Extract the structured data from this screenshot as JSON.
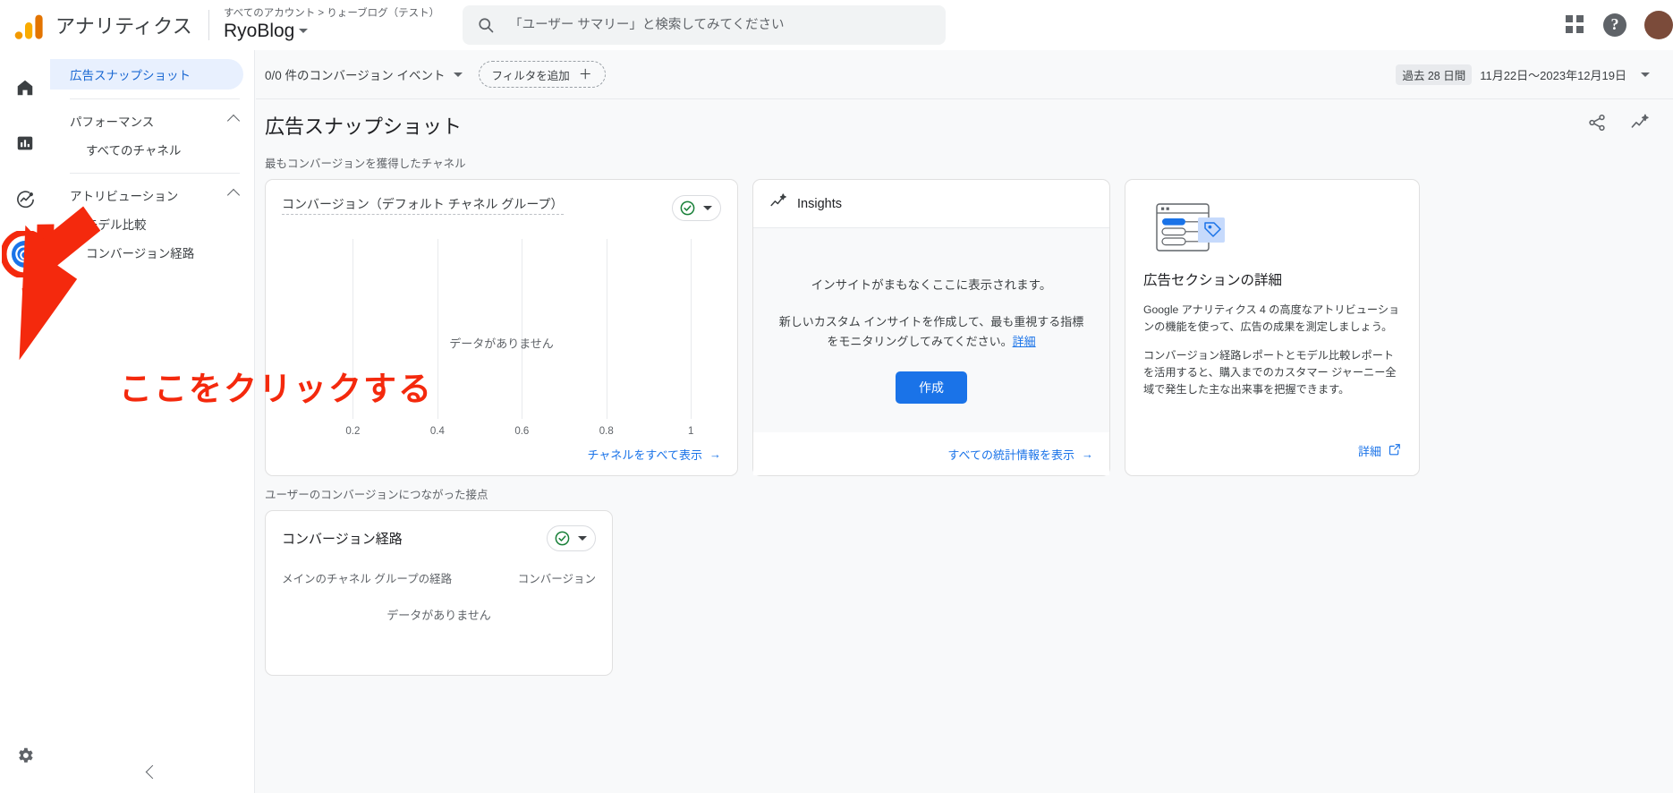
{
  "header": {
    "product_name": "アナリティクス",
    "account_path": "すべてのアカウント > りょーブログ（テスト）",
    "property_name": "RyoBlog",
    "search_placeholder": "「ユーザー サマリー」と検索してみてください",
    "icons": {
      "logo": "google-analytics-logo",
      "search": "search-icon",
      "apps": "apps-grid-icon",
      "help": "help-icon",
      "avatar": "user-avatar"
    }
  },
  "rail": {
    "items": [
      {
        "name": "home",
        "label": "ホーム",
        "icon": "home-icon",
        "active": false
      },
      {
        "name": "reports",
        "label": "レポート",
        "icon": "bar-chart-icon",
        "active": false
      },
      {
        "name": "explore",
        "label": "探索",
        "icon": "explore-icon",
        "active": false
      },
      {
        "name": "advertising",
        "label": "広告",
        "icon": "advertising-radar-icon",
        "active": true
      },
      {
        "name": "admin",
        "label": "管理",
        "icon": "gear-icon",
        "active": false
      }
    ]
  },
  "sidebar": {
    "selected_item": "広告スナップショット",
    "groups": [
      {
        "title": "パフォーマンス",
        "expanded": true,
        "items": [
          "すべてのチャネル"
        ]
      },
      {
        "title": "アトリビューション",
        "expanded": true,
        "items": [
          "モデル比較",
          "コンバージョン経路"
        ]
      }
    ],
    "collapse_label": "折りたたむ"
  },
  "toolbar": {
    "conversion_events": "0/0 件のコンバージョン イベント",
    "add_filter": "フィルタを追加",
    "date_badge": "過去 28 日間",
    "date_range": "11月22日〜2023年12月19日"
  },
  "page": {
    "title": "広告スナップショット",
    "actions": [
      {
        "name": "share",
        "icon": "share-icon"
      },
      {
        "name": "insights",
        "icon": "insights-sparkle-icon"
      }
    ]
  },
  "section_top": {
    "label": "最もコンバージョンを獲得したチャネル"
  },
  "card_channels": {
    "metric_label": "コンバージョン（デフォルト チャネル グループ）",
    "status_icon": "check-circle-icon",
    "no_data": "データがありません",
    "footer_link": "チャネルをすべて表示"
  },
  "card_insights": {
    "title": "Insights",
    "icon": "insights-sparkle-icon",
    "line1": "インサイトがまもなくここに表示されます。",
    "line2": "新しいカスタム インサイトを作成して、最も重視する指標をモニタリングしてみてください。",
    "line2_link": "詳細",
    "create_button": "作成",
    "footer_link": "すべての統計情報を表示"
  },
  "card_ads_detail": {
    "illustration": "ads-section-illustration",
    "title": "広告セクションの詳細",
    "paragraph1": "Google アナリティクス 4 の高度なアトリビューションの機能を使って、広告の成果を測定しましょう。",
    "paragraph2": "コンバージョン経路レポートとモデル比較レポートを活用すると、購入までのカスタマー ジャーニー全域で発生した主な出来事を把握できます。",
    "footer_link": "詳細",
    "footer_icon": "external-link-icon"
  },
  "section_bottom": {
    "label": "ユーザーのコンバージョンにつながった接点"
  },
  "card_paths": {
    "title": "コンバージョン経路",
    "status_icon": "check-circle-icon",
    "column_left": "メインのチャネル グループの経路",
    "column_right": "コンバージョン",
    "no_data": "データがありません"
  },
  "chart_data": {
    "type": "bar",
    "title": "コンバージョン（デフォルト チャネル グループ）",
    "categories": [],
    "values": [],
    "series": [],
    "x_ticks": [
      "0.2",
      "0.4",
      "0.6",
      "0.8",
      "1"
    ],
    "xlim": [
      0,
      1
    ],
    "xlabel": "",
    "ylabel": "",
    "grid": true,
    "empty_message": "データがありません",
    "legend": "none"
  },
  "annotation": {
    "text": "ここをクリックする",
    "color": "#f4290d",
    "arrow": "red-arrow-pointing-to-advertising-icon",
    "highlight_target": "advertising-rail-icon"
  },
  "colors": {
    "accent_blue": "#1a73e8",
    "link_blue": "#1967d2",
    "selected_bg": "#e8f0fe",
    "success_green": "#188038",
    "annotation_red": "#f4290d",
    "page_bg": "#f8f9fa",
    "card_border": "#e0e0e0"
  }
}
